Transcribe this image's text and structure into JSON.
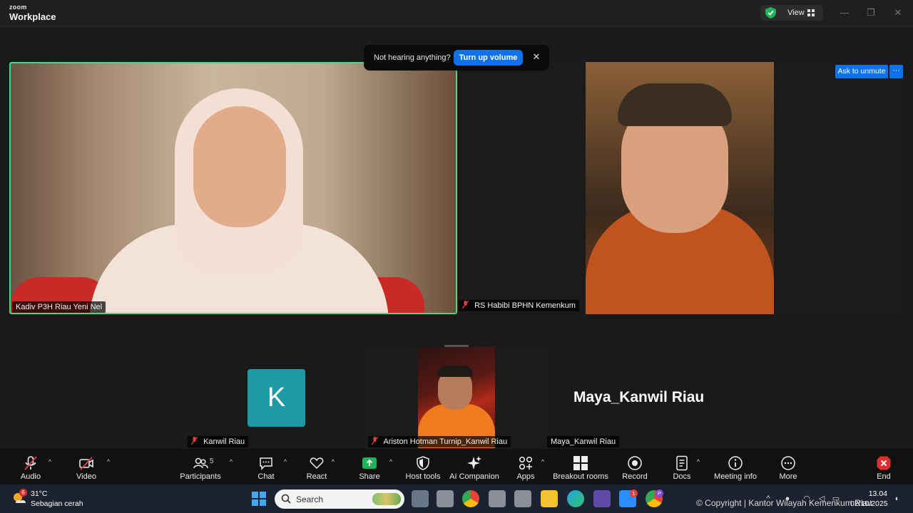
{
  "app": {
    "brand_top": "zoom",
    "brand_bottom": "Workplace",
    "view_label": "View"
  },
  "window_controls": {
    "minimize": "—",
    "maximize": "❐",
    "close": "✕"
  },
  "toast": {
    "message": "Not hearing anything?",
    "button": "Turn up volume",
    "close": "✕"
  },
  "ask_unmute": {
    "label": "Ask to unmute",
    "more": "···"
  },
  "participants": {
    "tile_a": {
      "name": "Kadiv P3H Riau Yeni Nel"
    },
    "tile_b": {
      "name": "RS Habibi BPHN Kemenkum"
    },
    "tile_k": {
      "initial": "K",
      "name": "Kanwil Riau"
    },
    "tile_c": {
      "name": "Ariston Hotman Turnip_Kanwil Riau"
    },
    "tile_maya": {
      "display": "Maya_Kanwil Riau",
      "name": "Maya_Kanwil Riau"
    }
  },
  "toolbar": {
    "audio": "Audio",
    "video": "Video",
    "participants": "Participants",
    "participants_count": "5",
    "chat": "Chat",
    "react": "React",
    "share": "Share",
    "host_tools": "Host tools",
    "ai_companion": "AI Companion",
    "apps": "Apps",
    "breakout_rooms": "Breakout rooms",
    "record": "Record",
    "docs": "Docs",
    "meeting_info": "Meeting info",
    "more": "More",
    "end": "End",
    "caret": "^"
  },
  "taskbar": {
    "weather_badge": "6",
    "temperature": "31°C",
    "condition": "Sebagian cerah",
    "search_label": "Search",
    "zoom_badge": "1",
    "chrome_badge": "P",
    "copyright": "© Copyright | Kantor Wilayah Kemenkum Riau",
    "time": "13.04",
    "date": "02/10/2025"
  },
  "colors": {
    "accent": "#0e72ed",
    "active_speaker": "#3ddc84",
    "share_green": "#1fb35a",
    "end_red": "#e02d2d",
    "avatar_teal": "#1e9aa6"
  }
}
